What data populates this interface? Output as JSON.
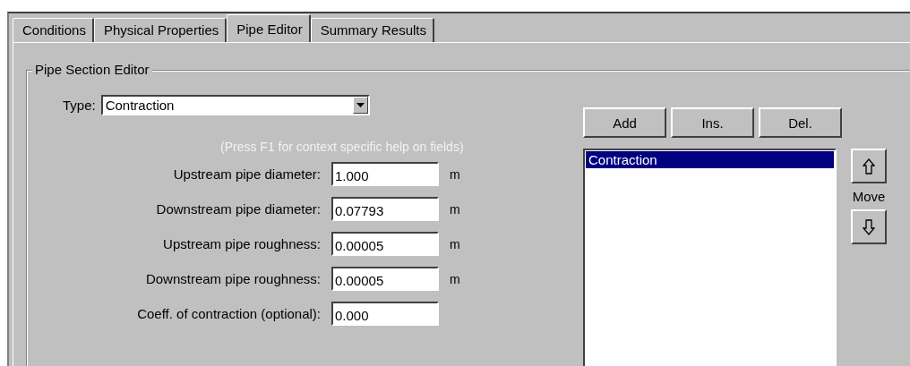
{
  "tabs": [
    {
      "label": "Conditions",
      "selected": false
    },
    {
      "label": "Physical Properties",
      "selected": false
    },
    {
      "label": "Pipe Editor",
      "selected": true
    },
    {
      "label": "Summary Results",
      "selected": false
    }
  ],
  "group": {
    "title": "Pipe Section Editor",
    "type_label": "Type:",
    "type_value": "Contraction",
    "help": "(Press F1 for context specific help on fields)",
    "fields": [
      {
        "label": "Upstream pipe diameter:",
        "value": "1.000",
        "unit": "m"
      },
      {
        "label": "Downstream pipe diameter:",
        "value": "0.07793",
        "unit": "m"
      },
      {
        "label": "Upstream pipe roughness:",
        "value": "0.00005",
        "unit": "m"
      },
      {
        "label": "Downstream pipe roughness:",
        "value": "0.00005",
        "unit": "m"
      },
      {
        "label": "Coeff. of contraction (optional):",
        "value": "0.000"
      }
    ],
    "buttons": [
      "Add",
      "Ins.",
      "Del."
    ],
    "sections": [
      {
        "label": "Contraction",
        "selected": true
      }
    ],
    "move_label": "Move"
  }
}
